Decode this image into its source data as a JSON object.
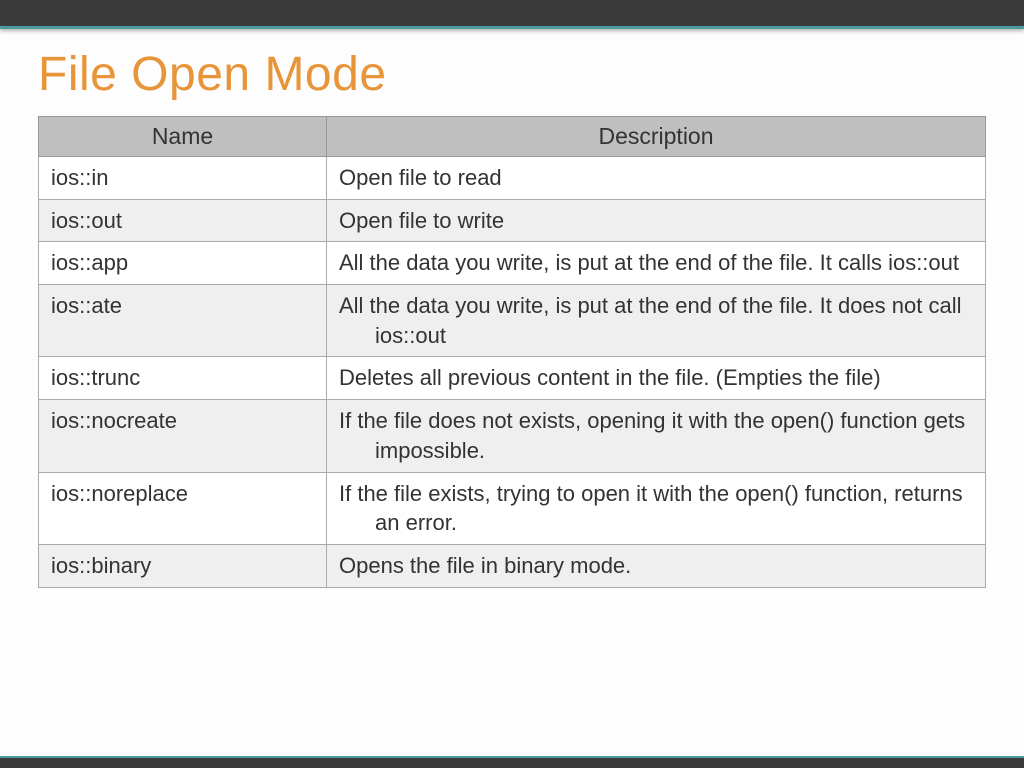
{
  "title": "File Open Mode",
  "columns": {
    "name": "Name",
    "description": "Description"
  },
  "rows": [
    {
      "name": "ios::in",
      "description": "Open file to read"
    },
    {
      "name": "ios::out",
      "description": "Open file to write"
    },
    {
      "name": "ios::app",
      "description": "All the data you write, is put at the end of the file. It calls ios::out"
    },
    {
      "name": "ios::ate",
      "description": "All the data you write, is put at the end of the file. It does not call ios::out"
    },
    {
      "name": "ios::trunc",
      "description": "Deletes all previous content in the file. (Empties the file)"
    },
    {
      "name": "ios::nocreate",
      "description": "If the file does not exists, opening it with the open() function gets impossible."
    },
    {
      "name": "ios::noreplace",
      "description": "If the file exists, trying to open it with the open() function, returns an error."
    },
    {
      "name": "ios::binary",
      "description": "Opens the file in binary mode."
    }
  ]
}
